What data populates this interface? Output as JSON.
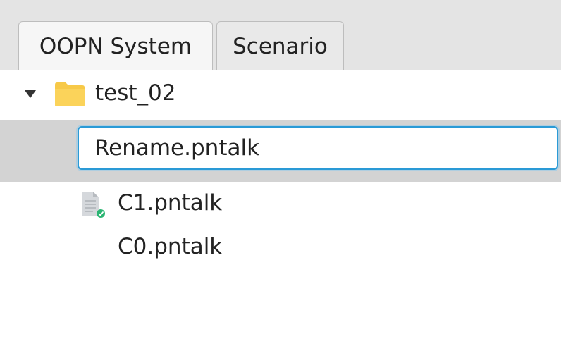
{
  "tabs": [
    {
      "label": "OOPN System",
      "selected": true
    },
    {
      "label": "Scenario",
      "selected": false
    }
  ],
  "tree": {
    "root": {
      "label": "test_02",
      "expanded": true,
      "icon": "folder-icon"
    },
    "rename_input": {
      "value": "Rename.pntalk"
    },
    "items": [
      {
        "label": "C1.pntalk",
        "icon": "file-check-icon"
      },
      {
        "label": "C0.pntalk",
        "icon": ""
      }
    ]
  },
  "colors": {
    "folder": "#f7c948",
    "selection": "#d3d3d3",
    "focus_border": "#2a9ad6",
    "check": "#2bb573"
  }
}
